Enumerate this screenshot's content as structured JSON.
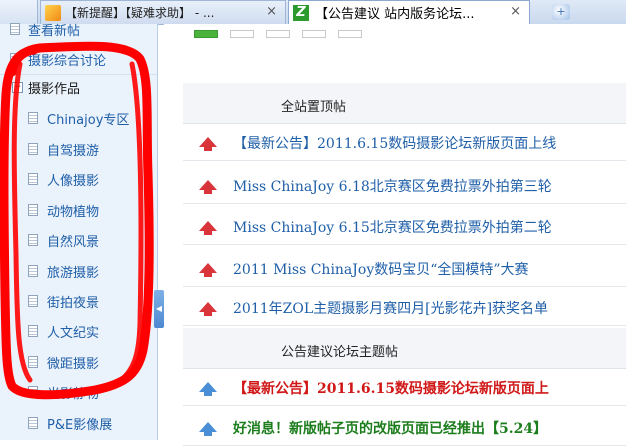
{
  "browser": {
    "tabs": [
      {
        "label": "【新提醒】【疑难求助】 - ...",
        "active": false
      },
      {
        "label": "【公告建议 站内版务论坛...",
        "active": true
      }
    ],
    "close_glyph": "×"
  },
  "sidebar": {
    "top_items": [
      "查看新帖",
      "摄影综合讨论"
    ],
    "group": {
      "label": "摄影作品",
      "expander": "−"
    },
    "items": [
      "Chinajoy专区",
      "自驾摄游",
      "人像摄影",
      "动物植物",
      "自然风景",
      "旅游摄影",
      "街拍夜景",
      "人文纪实",
      "微距摄影",
      "光影静物",
      "P&E影像展"
    ],
    "collapse_glyph": "◀"
  },
  "main": {
    "sticky_header": "全站置顶帖",
    "sticky_posts": [
      {
        "parts": [
          {
            "text": "【最新公告】",
            "style": "link"
          },
          {
            "text": "2011.6.15数码摄影论坛新版页面上线",
            "style": "link"
          }
        ]
      },
      {
        "parts": [
          {
            "text": "Miss ChinaJoy 6.18北京赛区免费拉票外拍第三轮",
            "style": "link"
          }
        ]
      },
      {
        "parts": [
          {
            "text": "Miss ChinaJoy 6.15北京赛区免费拉票外拍第二轮",
            "style": "link"
          }
        ]
      },
      {
        "parts": [
          {
            "text": "2011 Miss ChinaJoy数码宝贝“全国模特”大赛",
            "style": "link"
          }
        ]
      },
      {
        "parts": [
          {
            "text": "2011年ZOL主题摄影月赛四月[光影花卉]获奖名单",
            "style": "link"
          }
        ]
      }
    ],
    "forum_header": "公告建议论坛主题帖",
    "forum_posts": [
      {
        "text": "【最新公告】2011.6.15数码摄影论坛新版页面上",
        "style": "red"
      },
      {
        "text": "好消息！新版帖子页的改版页面已经推出【5.24】",
        "style": "green"
      }
    ]
  },
  "colors": {
    "link": "#1f5fa8",
    "announce_red": "#d01818",
    "good_green": "#1d7d1d",
    "sidebar_bg": "#eaf2fb",
    "scribble": "#ff0000"
  }
}
